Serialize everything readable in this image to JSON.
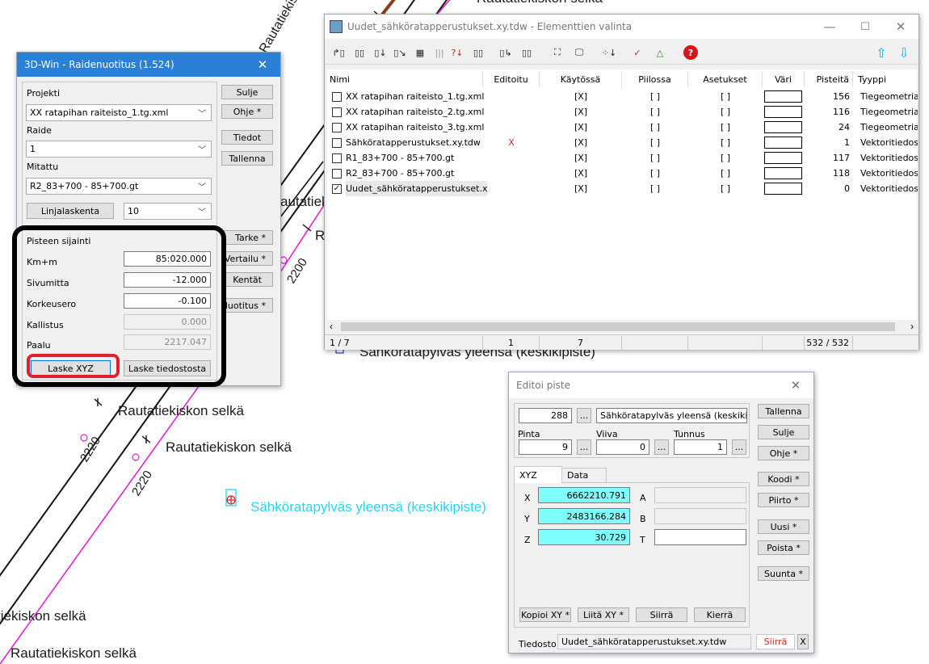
{
  "cad_labels": {
    "top_cut": "Rautatiekiskon selkä",
    "left_r1": "Rautatiekiskon selkä",
    "left_r2": "Rautatiekiskon selkä",
    "left_r3": "tiekiskon selkä",
    "left_r4": "Rautatiekiskon selkä",
    "rot_upper": "Rautatiekiskon s",
    "rot_autatiek": "autatiek",
    "r_letter": "R",
    "mast_label_cyan": "Sähköratapylväs yleensä (keskikipiste)",
    "mast_label_black": "Sähköratapylväs yleensä (keskikipiste)",
    "km_2220_a": "2220",
    "km_2220_b": "2220",
    "km_2200": "2200"
  },
  "raidenuotitus": {
    "title": "3D-Win - Raidenuotitus  (1.524)",
    "close_icon": "close-icon",
    "projekti_label": "Projekti",
    "projekti_value": "XX ratapihan raiteisto_1.tg.xml",
    "raide_label": "Raide",
    "raide_value": "1",
    "mitattu_label": "Mitattu",
    "mitattu_value": "R2_83+700 - 85+700.gt",
    "linjalaskenta_button": "Linjalaskenta",
    "linjalaskenta_value": "10",
    "pisteen_sijainti_label": "Pisteen sijainti",
    "kmm_label": "Km+m",
    "kmm_value": "85:020.000",
    "sivumitta_label": "Sivumitta",
    "sivumitta_value": "-12.000",
    "korkeusero_label": "Korkeusero",
    "korkeusero_value": "-0.100",
    "kallistus_label": "Kallistus",
    "kallistus_value": "0.000",
    "paalu_label": "Paalu",
    "paalu_value": "2217.047",
    "laske_xyz_button": "Laske XYZ",
    "laske_tiedostosta_button": "Laske tiedostosta",
    "side_buttons": {
      "sulje": "Sulje",
      "ohje": "Ohje *",
      "tiedot": "Tiedot",
      "tallenna": "Tallenna",
      "tarke": "Tarke *",
      "vertailu": "Vertailu *",
      "kentat": "Kentät",
      "nuotitus": "Nuotitus *"
    },
    "highlight_color": "#000000",
    "red_highlight_color": "#e0202a"
  },
  "elementit": {
    "title": "Uudet_sähköratapperustukset.xy.tdw - Elementtien valinta",
    "title_display": "Uudet_sähköratapperustukset.xy.tdw - Elementtien valinta",
    "minimize_icon": "minimize-icon",
    "maximize_icon": "maximize-icon",
    "close_icon": "close-icon",
    "columns": [
      "Nimi",
      "Editoitu",
      "Käytössä",
      "Piilossa",
      "Asetukset",
      "Väri",
      "Pisteitä",
      "Tyyppi"
    ],
    "rows": [
      {
        "checked": false,
        "name": "XX ratapihan raiteisto_1.tg.xml",
        "editoitu": "",
        "kaytossa": "[X]",
        "piilossa": "[ ]",
        "asetukset": "[ ]",
        "pisteita": "156",
        "tyyppi": "Tiegeometria"
      },
      {
        "checked": false,
        "name": "XX ratapihan raiteisto_2.tg.xml",
        "editoitu": "",
        "kaytossa": "[X]",
        "piilossa": "[ ]",
        "asetukset": "[ ]",
        "pisteita": "116",
        "tyyppi": "Tiegeometria"
      },
      {
        "checked": false,
        "name": "XX ratapihan raiteisto_3.tg.xml",
        "editoitu": "",
        "kaytossa": "[X]",
        "piilossa": "[ ]",
        "asetukset": "[ ]",
        "pisteita": "24",
        "tyyppi": "Tiegeometria"
      },
      {
        "checked": false,
        "name": "Sähköratapperustukset.xy.tdw",
        "editoitu": "X",
        "kaytossa": "[X]",
        "piilossa": "[ ]",
        "asetukset": "[ ]",
        "pisteita": "1",
        "tyyppi": "Vektoritiedost"
      },
      {
        "checked": false,
        "name": "R1_83+700 - 85+700.gt",
        "editoitu": "",
        "kaytossa": "[X]",
        "piilossa": "[ ]",
        "asetukset": "[ ]",
        "pisteita": "117",
        "tyyppi": "Vektoritiedost"
      },
      {
        "checked": false,
        "name": "R2_83+700 - 85+700.gt",
        "editoitu": "",
        "kaytossa": "[X]",
        "piilossa": "[ ]",
        "asetukset": "[ ]",
        "pisteita": "118",
        "tyyppi": "Vektoritiedost"
      },
      {
        "checked": true,
        "name": "Uudet_sähköratapperustukset.x...",
        "editoitu": "",
        "kaytossa": "[X]",
        "piilossa": "[ ]",
        "asetukset": "[ ]",
        "pisteita": "0",
        "tyyppi": "Vektoritiedost"
      }
    ],
    "status": {
      "count": "1 / 7",
      "editoitu": "1",
      "kaytossa": "7",
      "pisteita": "532 / 532"
    },
    "scroll_left_icon": "chevron-left-icon",
    "scroll_right_icon": "chevron-right-icon",
    "editoitu_color": "#d02020"
  },
  "editoi_piste": {
    "title": "Editoi piste",
    "close_icon": "close-icon",
    "point_number": "288",
    "point_desc": "Sähköratapylväs yleensä (keskikipiste",
    "pinta_label": "Pinta",
    "pinta_value": "9",
    "viiva_label": "Viiva",
    "viiva_value": "0",
    "tunnus_label": "Tunnus",
    "tunnus_value": "1",
    "ellipsis": "...",
    "tab_xyz": "XYZ",
    "tab_data": "Data",
    "x_label": "X",
    "x_value": "6662210.791",
    "y_label": "Y",
    "y_value": "2483166.284",
    "z_label": "Z",
    "z_value": "30.729",
    "a_label": "A",
    "b_label": "B",
    "t_label": "T",
    "kopioi_xy": "Kopioi XY *",
    "liita_xy": "Liitä XY *",
    "siirra": "Siirrä",
    "kierra": "Kierrä",
    "tiedosto_label": "Tiedosto",
    "tiedosto_value": "Uudet_sähköratapperustukset.xy.tdw",
    "siirra_red": "Siirrä",
    "x_close": "X",
    "side_buttons": {
      "tallenna": "Tallenna",
      "sulje": "Sulje",
      "ohje": "Ohje *",
      "koodi": "Koodi *",
      "piirto": "Piirto *",
      "uusi": "Uusi *",
      "poista": "Poista *",
      "suunta": "Suunta *"
    },
    "cyan_color": "#80ffff"
  }
}
